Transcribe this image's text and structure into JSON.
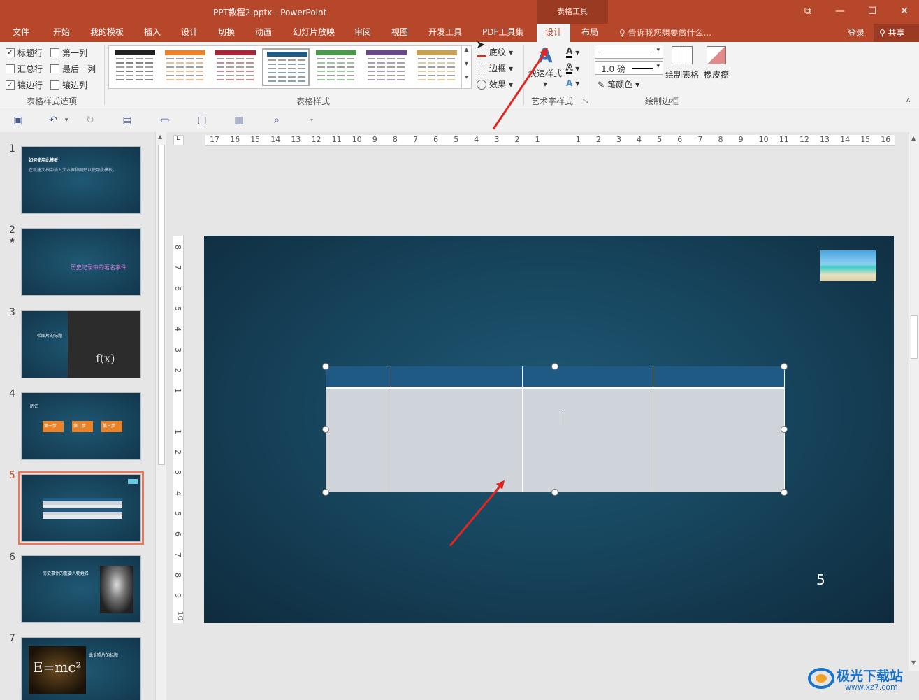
{
  "titlebar": {
    "doc_title": "PPT教程2.pptx - PowerPoint",
    "context_group": "表格工具"
  },
  "tabs": [
    "文件",
    "开始",
    "我的模板",
    "插入",
    "设计",
    "切换",
    "动画",
    "幻灯片放映",
    "审阅",
    "视图",
    "开发工具",
    "PDF工具集",
    "设计",
    "布局"
  ],
  "active_tab_index": 12,
  "tell_me": "告诉我您想要做什么...",
  "login": "登录",
  "share": "共享",
  "ribbon": {
    "options": {
      "label": "表格样式选项",
      "items": [
        {
          "label": "标题行",
          "checked": true
        },
        {
          "label": "第一列",
          "checked": false
        },
        {
          "label": "汇总行",
          "checked": false
        },
        {
          "label": "最后一列",
          "checked": false
        },
        {
          "label": "镶边行",
          "checked": true
        },
        {
          "label": "镶边列",
          "checked": false
        }
      ]
    },
    "styles_label": "表格样式",
    "style_colors": [
      "#222222",
      "#e8832a",
      "#a8283a",
      "#1e5a83",
      "#4a9a4a",
      "#6a4a8a",
      "#c8a050"
    ],
    "shading": "底纹",
    "borders": "边框",
    "effects": "效果",
    "quick_styles": "快速样式",
    "wordart_label": "艺术字样式",
    "pen_weight": "1.0 磅",
    "pen_color": "笔颜色",
    "draw_table": "绘制表格",
    "eraser": "橡皮擦",
    "draw_borders_label": "绘制边框"
  },
  "slides": [
    {
      "num": "1",
      "texts": [
        "如何使用此模板",
        "在新建文档中插入文本框和图形以使用此模板。"
      ]
    },
    {
      "num": "2",
      "texts": [
        "历史记录中的著名事件"
      ]
    },
    {
      "num": "3",
      "texts": [
        "带图片的标题"
      ]
    },
    {
      "num": "4",
      "texts": [
        "历史",
        "第一步",
        "第二步",
        "第三步"
      ]
    },
    {
      "num": "5",
      "texts": []
    },
    {
      "num": "6",
      "texts": [
        "历史事件的重要人物姓名"
      ]
    },
    {
      "num": "7",
      "texts": [
        "此处照片的标题"
      ]
    }
  ],
  "current_slide": "5",
  "slide_number_label": "5",
  "hruler": [
    "17",
    "16",
    "15",
    "14",
    "13",
    "12",
    "11",
    "10",
    "9",
    "8",
    "7",
    "6",
    "5",
    "4",
    "3",
    "2",
    "1",
    "",
    "1",
    "2",
    "3",
    "4",
    "5",
    "6",
    "7",
    "8",
    "9",
    "10",
    "11",
    "12",
    "13",
    "14",
    "15",
    "16"
  ],
  "vruler": [
    "8",
    "7",
    "6",
    "5",
    "4",
    "3",
    "2",
    "1",
    "",
    "1",
    "2",
    "3",
    "4",
    "5",
    "6",
    "7",
    "8",
    "9",
    "10"
  ],
  "watermark": {
    "name": "极光下载站",
    "url": "www.xz7.com"
  }
}
